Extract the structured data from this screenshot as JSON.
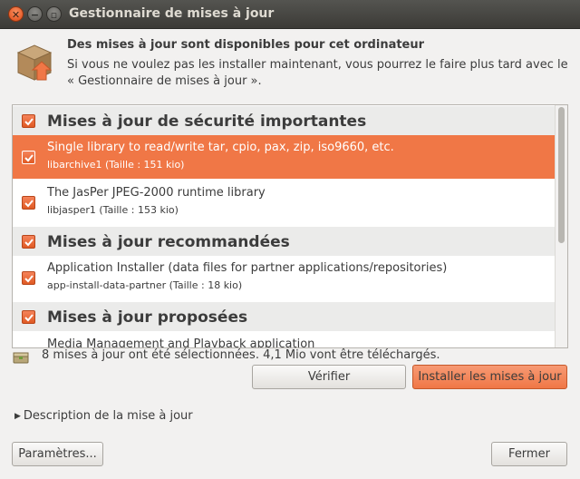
{
  "window": {
    "title": "Gestionnaire de mises à jour",
    "close_glyph": "✕",
    "min_glyph": "−",
    "max_glyph": "▫"
  },
  "header": {
    "icon": "package-upgrade-icon",
    "title": "Des mises à jour sont disponibles pour cet ordinateur",
    "description": "Si vous ne voulez pas les installer maintenant, vous pourrez le faire plus tard avec le « Gestionnaire de mises à jour »."
  },
  "updates": {
    "categories": [
      {
        "label": "Mises à jour de sécurité importantes",
        "checked": true,
        "items": [
          {
            "title": "Single library to read/write tar, cpio, pax, zip, iso9660, etc.",
            "detail": "libarchive1 (Taille : 151 kio)",
            "checked": true,
            "selected": true
          },
          {
            "title": "The JasPer JPEG-2000 runtime library",
            "detail": "libjasper1 (Taille : 153 kio)",
            "checked": true,
            "selected": false
          }
        ]
      },
      {
        "label": "Mises à jour recommandées",
        "checked": true,
        "items": [
          {
            "title": "Application Installer (data files for partner applications/repositories)",
            "detail": "app-install-data-partner (Taille : 18 kio)",
            "checked": true,
            "selected": false
          }
        ]
      },
      {
        "label": "Mises à jour proposées",
        "checked": true,
        "items": [
          {
            "title": "Media Management and Playback application",
            "detail": "",
            "checked": true,
            "selected": false
          }
        ]
      }
    ]
  },
  "status": {
    "text": "8 mises à jour ont été sélectionnées. 4,1 Mio vont être téléchargés."
  },
  "buttons": {
    "verify": "Vérifier",
    "install": "Installer les mises à jour",
    "settings": "Paramètres...",
    "close": "Fermer"
  },
  "description_toggle": {
    "label": "Description de la mise à jour",
    "expanded": false
  },
  "colors": {
    "accent": "#f07746",
    "titlebar": "#3c3b37",
    "background": "#f2f1f0"
  }
}
